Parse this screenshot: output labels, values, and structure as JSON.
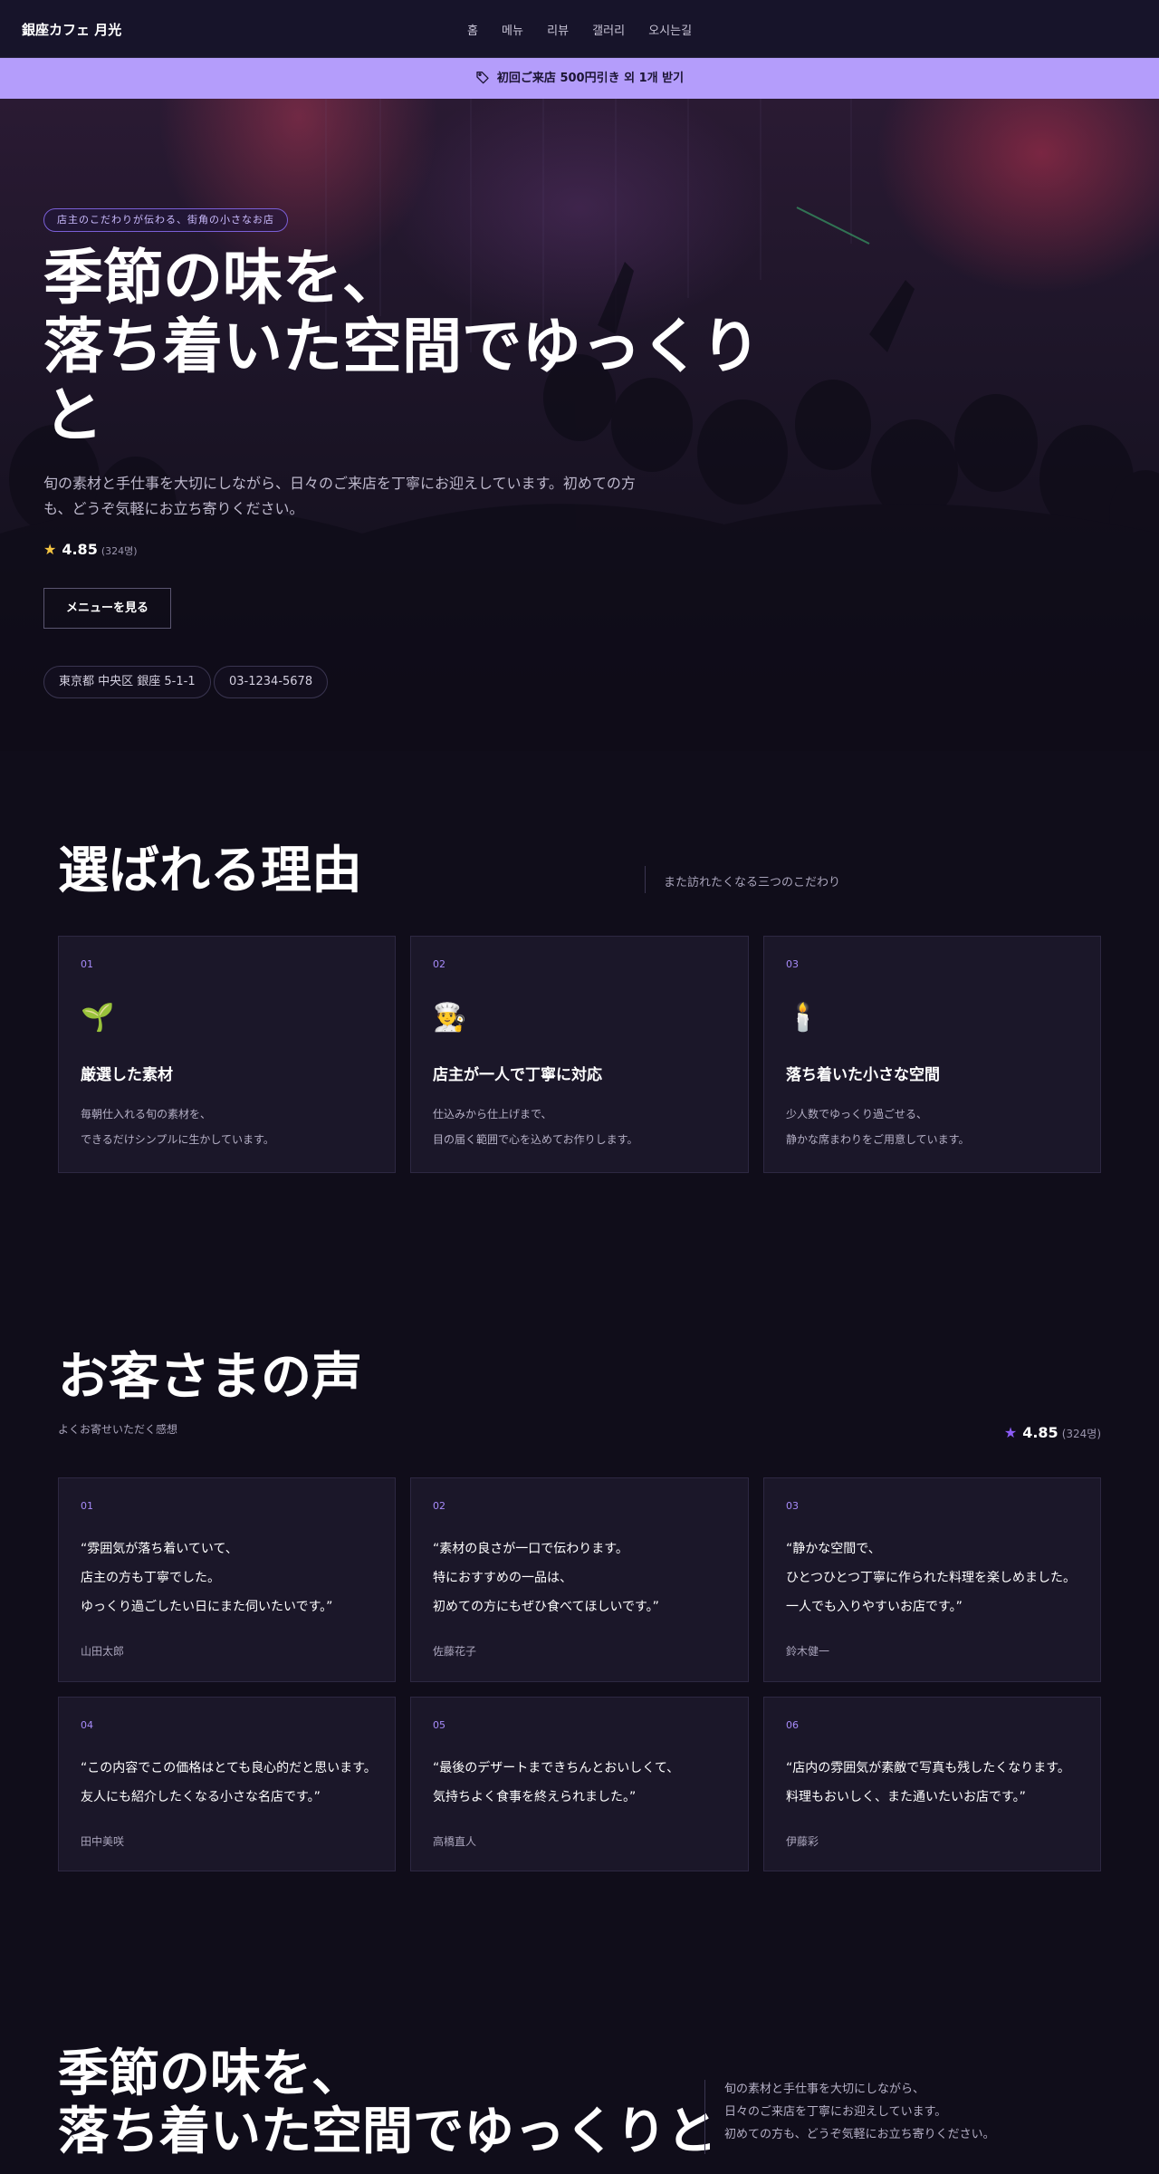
{
  "nav": {
    "brand": "銀座カフェ 月光",
    "links": [
      "홈",
      "메뉴",
      "리뷰",
      "갤러리",
      "오시는길"
    ]
  },
  "banner": {
    "icon": "tag-icon",
    "text": "初回ご来店 500円引き 외 1개 받기"
  },
  "hero": {
    "badge": "店主のこだわりが伝わる、街角の小さなお店",
    "title_lines": [
      "季節の味を、",
      "落ち着いた空間でゆっくり",
      "と"
    ],
    "description": "旬の素材と手仕事を大切にしながら、日々のご来店を丁寧にお迎えしています。初めての方も、どうぞ気軽にお立ち寄りください。",
    "rating": "4.85",
    "rating_count": "(324명)",
    "cta": "メニューを見る",
    "address": "東京都 中央区 銀座 5-1-1",
    "phone": "03-1234-5678"
  },
  "reasons": {
    "title": "選ばれる理由",
    "subtitle": "また訪れたくなる三つのこだわり",
    "cards": [
      {
        "num": "01",
        "icon": "sprout-icon",
        "emoji": "🌱",
        "title": "厳選した素材",
        "desc_lines": [
          "毎朝仕入れる旬の素材を、",
          "できるだけシンプルに生かしています。"
        ]
      },
      {
        "num": "02",
        "icon": "chef-icon",
        "emoji": "👨‍🍳",
        "title": "店主が一人で丁寧に対応",
        "desc_lines": [
          "仕込みから仕上げまで、",
          "目の届く範囲で心を込めてお作りします。"
        ]
      },
      {
        "num": "03",
        "icon": "candle-icon",
        "emoji": "🕯️",
        "title": "落ち着いた小さな空間",
        "desc_lines": [
          "少人数でゆっくり過ごせる、",
          "静かな席まわりをご用意しています。"
        ]
      }
    ]
  },
  "reviews": {
    "title": "お客さまの声",
    "subtitle": "よくお寄せいただく感想",
    "rating": "4.85",
    "rating_count": "(324명)",
    "items": [
      {
        "num": "01",
        "quote": "“雰囲気が落ち着いていて、\n店主の方も丁寧でした。\nゆっくり過ごしたい日にまた伺いたいです。”",
        "author": "山田太郎"
      },
      {
        "num": "02",
        "quote": "“素材の良さが一口で伝わります。\n特におすすめの一品は、\n初めての方にもぜひ食べてほしいです。”",
        "author": "佐藤花子"
      },
      {
        "num": "03",
        "quote": "“静かな空間で、\nひとつひとつ丁寧に作られた料理を楽しめました。\n一人でも入りやすいお店です。”",
        "author": "鈴木健一"
      },
      {
        "num": "04",
        "quote": "“この内容でこの価格はとても良心的だと思います。\n友人にも紹介したくなる小さな名店です。”",
        "author": "田中美咲"
      },
      {
        "num": "05",
        "quote": "“最後のデザートまできちんとおいしくて、\n気持ちよく食事を終えられました。”",
        "author": "高橋直人"
      },
      {
        "num": "06",
        "quote": "“店内の雰囲気が素敵で写真も残したくなります。\n料理もおいしく、また通いたいお店です。”",
        "author": "伊藤彩"
      }
    ]
  },
  "closing": {
    "title_lines": [
      "季節の味を、",
      "落ち着いた空間でゆっくりと"
    ],
    "desc_lines": [
      "旬の素材と手仕事を大切にしながら、",
      "日々のご来店を丁寧にお迎えしています。",
      "初めての方も、どうぞ気軽にお立ち寄りください。"
    ]
  },
  "colors": {
    "accent": "#a78bfa",
    "banner": "#b49dfb",
    "background": "#100d1a",
    "card": "#1b1729",
    "star": "#f5c542"
  }
}
